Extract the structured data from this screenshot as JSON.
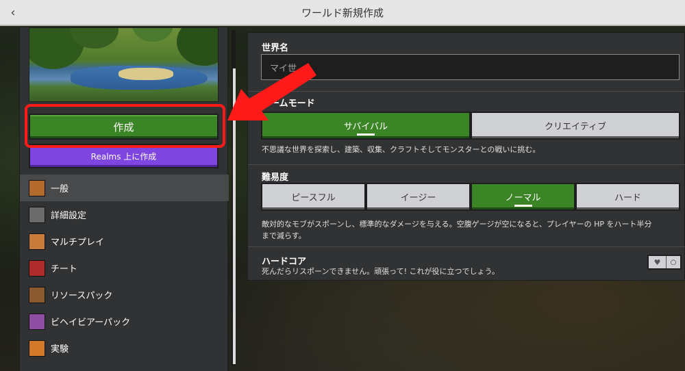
{
  "window": {
    "title": "ワールド新規作成",
    "back_icon": "chevron-left-icon"
  },
  "left": {
    "create_label": "作成",
    "realms_label": "Realms 上に作成",
    "nav": [
      {
        "label": "一般",
        "icon": "general-icon",
        "color": "#b36a2d",
        "active": true
      },
      {
        "label": "詳細設定",
        "icon": "advanced-icon",
        "color": "#6b6b6b",
        "active": false
      },
      {
        "label": "マルチプレイ",
        "icon": "multiplayer-icon",
        "color": "#c77c3c",
        "active": false
      },
      {
        "label": "チート",
        "icon": "cheats-icon",
        "color": "#b02b2b",
        "active": false
      },
      {
        "label": "リソースパック",
        "icon": "resource-pack-icon",
        "color": "#8a5a2e",
        "active": false
      },
      {
        "label": "ビヘイビアーパック",
        "icon": "behavior-pack-icon",
        "color": "#8e4fa3",
        "active": false
      },
      {
        "label": "実験",
        "icon": "experiments-icon",
        "color": "#d4782a",
        "active": false
      }
    ]
  },
  "right": {
    "world_name_label": "世界名",
    "world_name_value": "マイ世",
    "game_mode_label": "ゲームモード",
    "game_modes": [
      "サバイバル",
      "クリエイティブ"
    ],
    "game_mode_selected": "サバイバル",
    "game_mode_desc": "不思議な世界を探索し、建築、収集、クラフトそしてモンスターとの戦いに挑む。",
    "difficulty_label": "難易度",
    "difficulties": [
      "ピースフル",
      "イージー",
      "ノーマル",
      "ハード"
    ],
    "difficulty_selected": "ノーマル",
    "difficulty_desc_1": "敵対的なモブがスポーンし、標準的なダメージを与える。空腹ゲージが空になると、プレイヤーの HP をハート半分",
    "difficulty_desc_2": "まで減らす。",
    "hardcore_label": "ハードコア",
    "hardcore_desc": "死んだらリスポーンできません。頑張って! これが役に立つでしょう。",
    "hardcore_on": false
  },
  "colors": {
    "accent_green": "#3c8527",
    "realms_purple": "#7e45e0",
    "highlight_red": "#ff1a1a"
  }
}
